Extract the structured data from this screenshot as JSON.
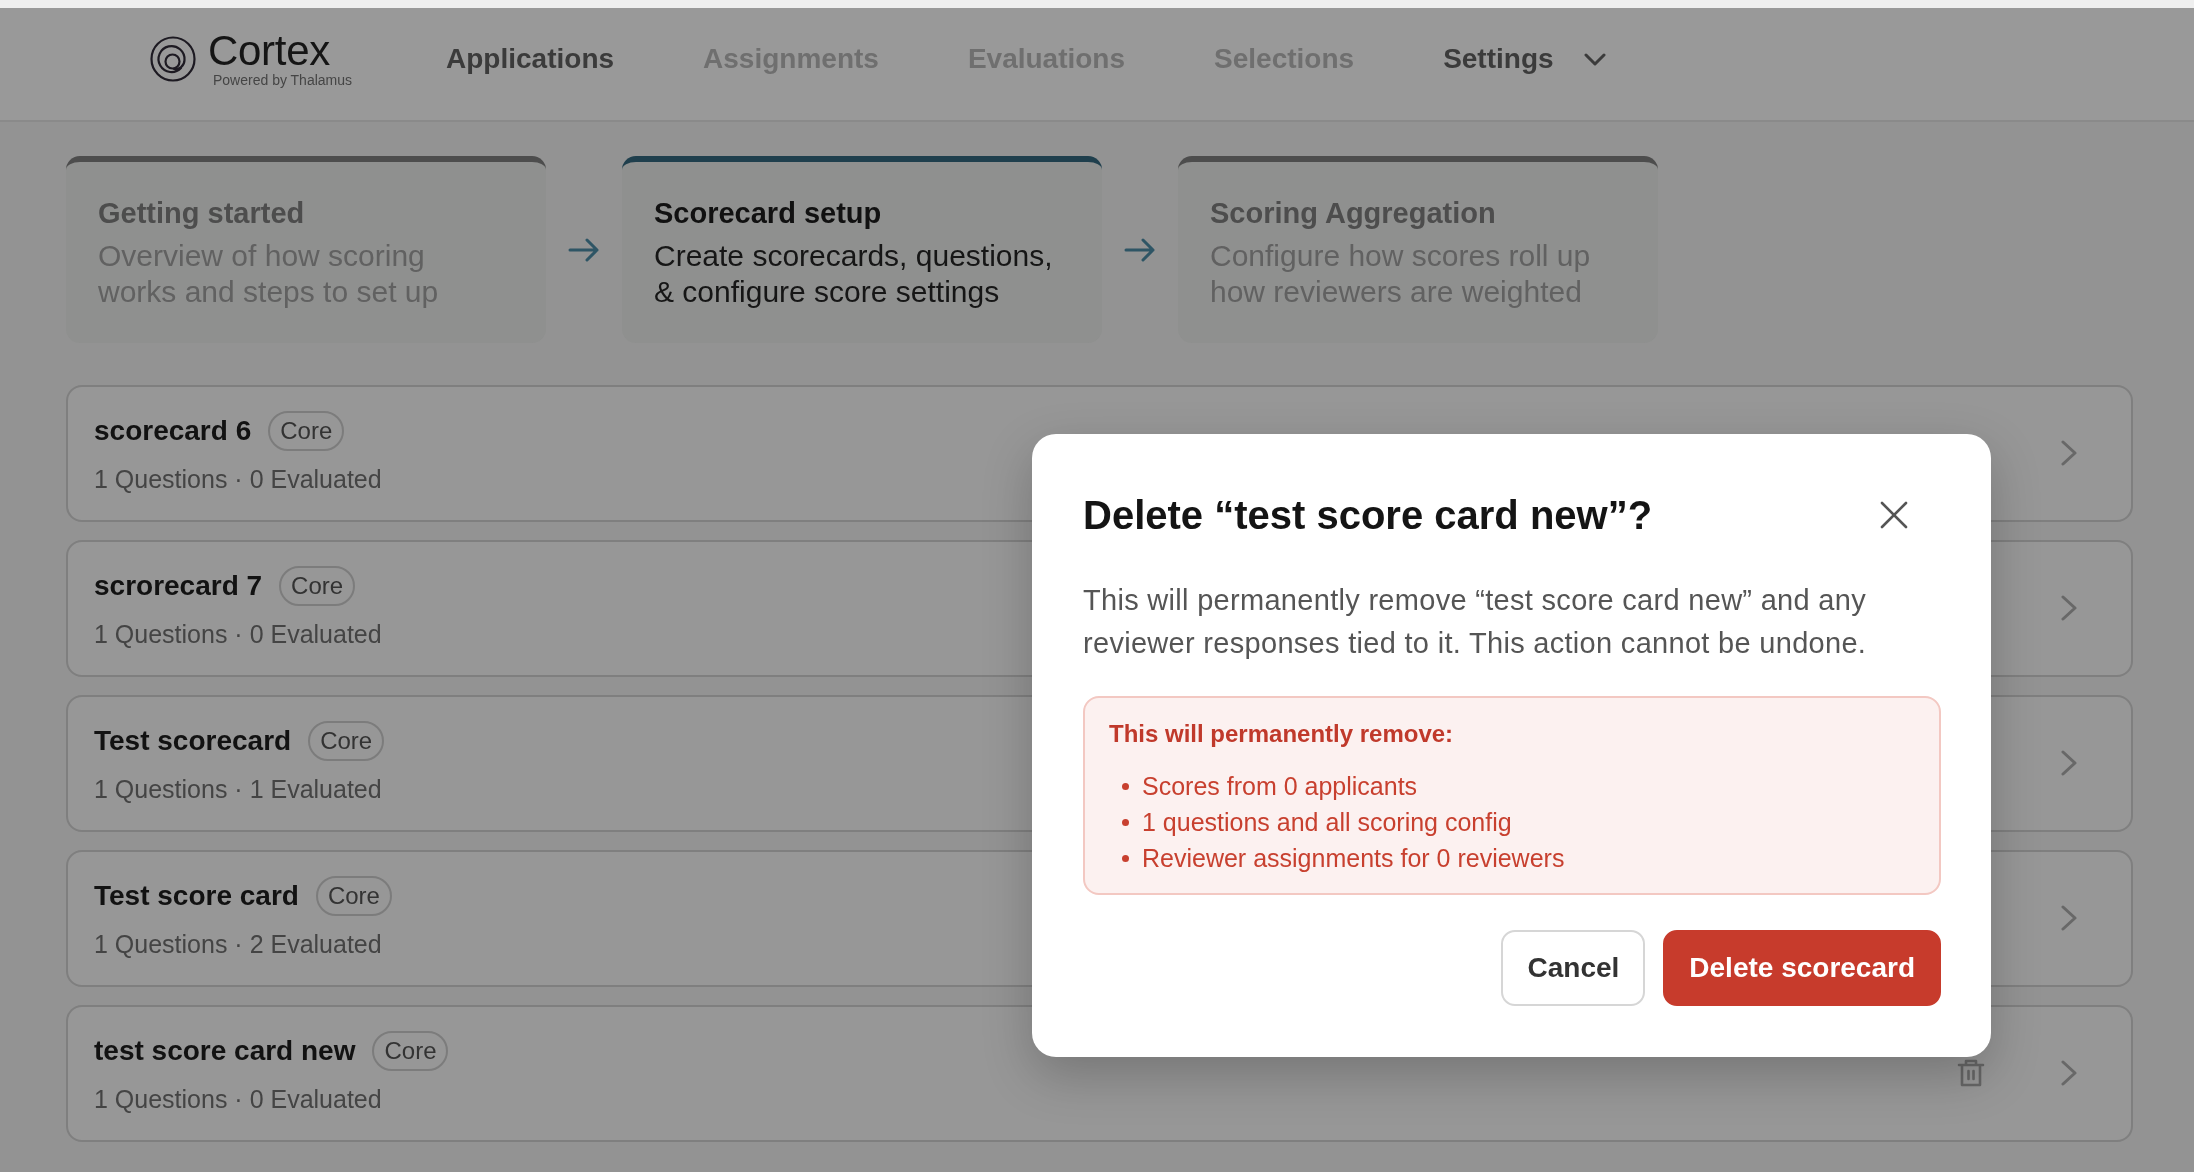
{
  "header": {
    "logo": {
      "name": "Cortex",
      "tagline": "Powered by Thalamus"
    },
    "nav": [
      {
        "label": "Applications",
        "disabled": false,
        "kind": "link"
      },
      {
        "label": "Assignments",
        "disabled": true,
        "kind": "link"
      },
      {
        "label": "Evaluations",
        "disabled": true,
        "kind": "link"
      },
      {
        "label": "Selections",
        "disabled": true,
        "kind": "link"
      },
      {
        "label": "Settings",
        "disabled": false,
        "kind": "dropdown"
      }
    ]
  },
  "steps": [
    {
      "title": "Getting started",
      "description": "Overview of how scoring works and steps to set up",
      "selected": false
    },
    {
      "title": "Scorecard setup",
      "description": "Create scorecards, questions, & configure score settings",
      "selected": true
    },
    {
      "title": "Scoring Aggregation",
      "description": "Configure how scores roll up how reviewers are weighted",
      "selected": false
    }
  ],
  "scorecards": [
    {
      "name": "scorecard 6",
      "tag": "Core",
      "meta": "1 Questions · 0 Evaluated",
      "actions": [
        {
          "kind": "open"
        }
      ]
    },
    {
      "name": "scrorecard 7",
      "tag": "Core",
      "meta": "1 Questions · 0 Evaluated",
      "actions": [
        {
          "kind": "open"
        }
      ]
    },
    {
      "name": "Test scorecard",
      "tag": "Core",
      "meta": "1 Questions · 1 Evaluated",
      "actions": [
        {
          "kind": "open"
        }
      ]
    },
    {
      "name": "Test score card",
      "tag": "Core",
      "meta": "1 Questions · 2 Evaluated",
      "actions": [
        {
          "kind": "open"
        }
      ]
    },
    {
      "name": "test score card new",
      "tag": "Core",
      "meta": "1 Questions · 0 Evaluated",
      "actions": [
        {
          "kind": "delete"
        },
        {
          "kind": "open"
        }
      ]
    }
  ],
  "dialog": {
    "title": "Delete “test score card new”?",
    "body": "This will permanently remove “test score card new” and any reviewer responses tied to it. This action cannot be undone.",
    "warning": {
      "heading": "This will permanently remove:",
      "items": [
        "Scores from 0 applicants",
        "1 questions and all scoring config",
        "Reviewer assignments for 0 reviewers"
      ]
    },
    "buttons": [
      {
        "label": "Cancel",
        "kind": "secondary"
      },
      {
        "label": "Delete scorecard",
        "kind": "danger"
      }
    ]
  }
}
